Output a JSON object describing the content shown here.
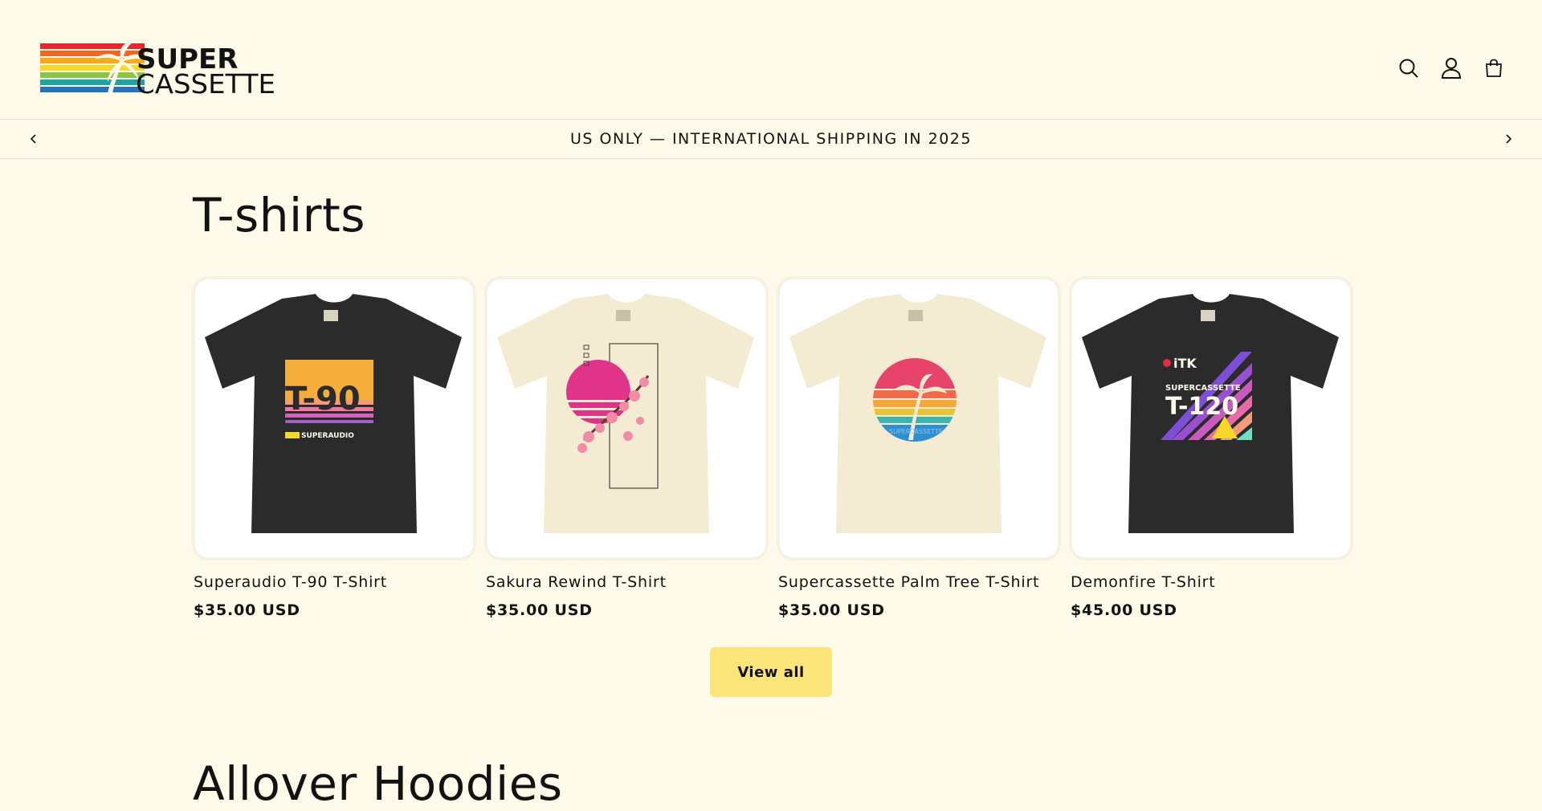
{
  "header": {
    "logo_text_line1": "SUPER",
    "logo_text_line2": "CASSETTE",
    "icons": [
      "search-icon",
      "account-icon",
      "cart-icon"
    ]
  },
  "announcement": {
    "text": "US ONLY — INTERNATIONAL SHIPPING IN 2025"
  },
  "sections": [
    {
      "title": "T-shirts",
      "products": [
        {
          "name": "Superaudio T-90 T-Shirt",
          "price": "$35.00 USD",
          "shirt_color": "#2b2b2b",
          "print_text": "T-90",
          "print_subtext": "SUPERAUDIO"
        },
        {
          "name": "Sakura Rewind T-Shirt",
          "price": "$35.00 USD",
          "shirt_color": "#f3ecd2"
        },
        {
          "name": "Supercassette Palm Tree T-Shirt",
          "price": "$35.00 USD",
          "shirt_color": "#f3ecd2",
          "print_text": "SUPERCASSETTE"
        },
        {
          "name": "Demonfire T-Shirt",
          "price": "$45.00 USD",
          "shirt_color": "#2b2b2b",
          "print_text": "T-120",
          "print_brand": "iTK",
          "print_subtext": "SUPERCASSETTE"
        }
      ],
      "view_all_label": "View all"
    },
    {
      "title": "Allover Hoodies"
    }
  ],
  "colors": {
    "background": "#fefae9",
    "button": "#fbe47a",
    "text": "#121212"
  }
}
